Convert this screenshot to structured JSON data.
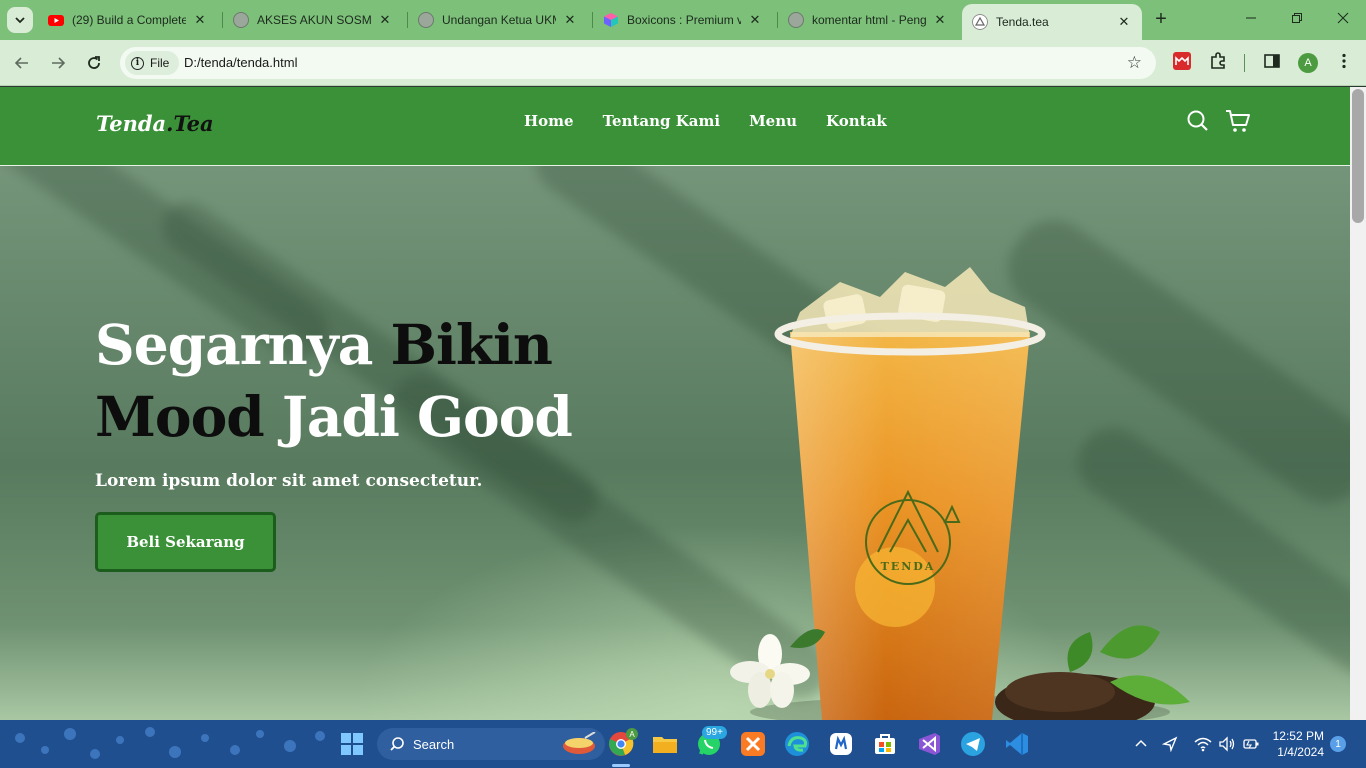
{
  "browser": {
    "tabs": [
      {
        "title": "(29) Build a Complete",
        "favicon": "youtube-icon",
        "active": false
      },
      {
        "title": "AKSES AKUN SOSMED",
        "favicon": "globe-icon",
        "active": false
      },
      {
        "title": "Undangan Ketua UKM",
        "favicon": "globe-icon",
        "active": false
      },
      {
        "title": "Boxicons : Premium v",
        "favicon": "boxicons-icon",
        "active": false
      },
      {
        "title": "komentar html - Peng",
        "favicon": "globe-icon",
        "active": false
      },
      {
        "title": "Tenda.tea",
        "favicon": "tenda-icon",
        "active": true
      }
    ],
    "new_tab_label": "+",
    "address": {
      "scheme_chip": "File",
      "url": "D:/tenda/tenda.html"
    },
    "profile_initial": "A"
  },
  "site": {
    "logo_main": "Tenda",
    "logo_suffix": ".Tea",
    "nav": [
      "Home",
      "Tentang Kami",
      "Menu",
      "Kontak"
    ],
    "hero": {
      "title_line1_a": "Segarnya",
      "title_line1_b": "Bikin",
      "title_line2_a": "Mood",
      "title_line2_b": "Jadi Good",
      "subtitle": "Lorem ipsum dolor sit amet consectetur.",
      "cta_label": "Beli Sekarang",
      "cup_brand": "TENDA"
    },
    "colors": {
      "primary": "#3a9138",
      "primary_dark": "#1c5c1c",
      "text_dark": "#0d0d0d"
    }
  },
  "taskbar": {
    "search_label": "Search",
    "whatsapp_badge": "99+",
    "clock_time": "12:52 PM",
    "clock_date": "1/4/2024",
    "notification_count": "1"
  }
}
